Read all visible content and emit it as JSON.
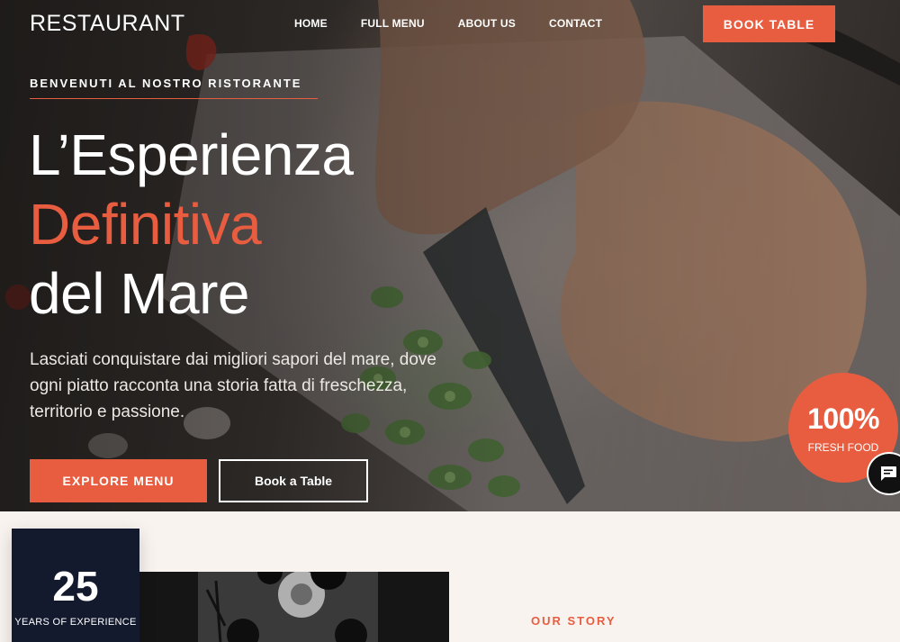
{
  "brand": {
    "logo": "RESTAURANT",
    "accent_color": "#e85d40",
    "dark_color": "#131a2e"
  },
  "nav": {
    "items": [
      {
        "label": "HOME"
      },
      {
        "label": "FULL MENU"
      },
      {
        "label": "ABOUT US"
      },
      {
        "label": "CONTACT"
      }
    ],
    "cta": "BOOK TABLE"
  },
  "hero": {
    "eyebrow": "BENVENUTI AL NOSTRO RISTORANTE",
    "headline_line1": "L’Esperienza",
    "headline_accent": "Definitiva",
    "headline_line3": "del Mare",
    "lead": "Lasciati conquistare dai migliori sapori del mare, dove ogni piatto racconta una storia fatta di freschezza, territorio e passione.",
    "primary_button": "EXPLORE MENU",
    "secondary_button": "Book a Table",
    "badge": {
      "value": "100%",
      "label": "FRESH FOOD"
    },
    "chat_icon": "chat-icon"
  },
  "about": {
    "experience": {
      "value": "25",
      "label": "YEARS OF EXPERIENCE"
    },
    "story_label": "OUR STORY"
  }
}
